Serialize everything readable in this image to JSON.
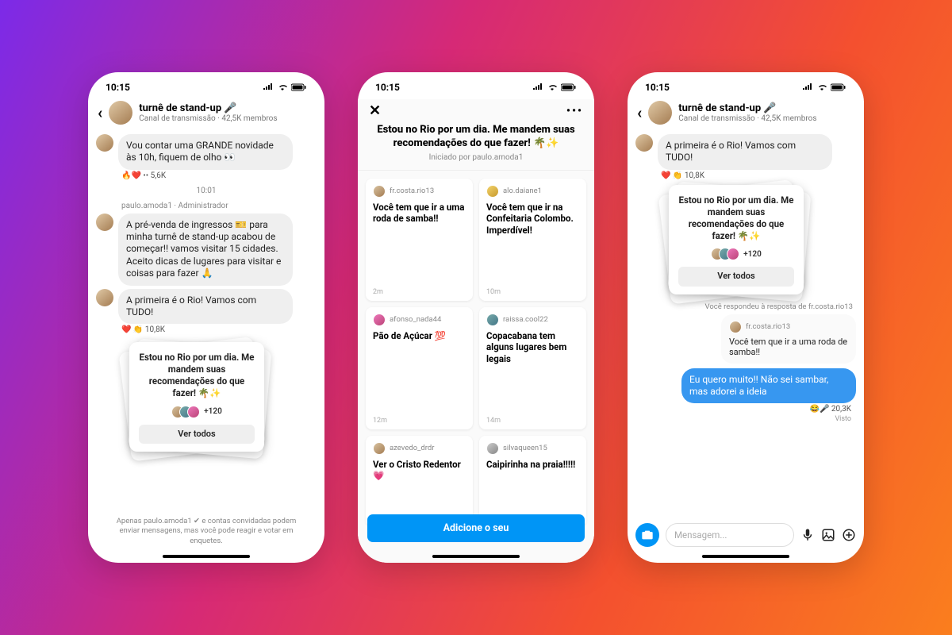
{
  "status_time": "10:15",
  "channel": {
    "title": "turnê de stand-up 🎤",
    "subtitle": "Canal de transmissão · 42,5K membros"
  },
  "phone1": {
    "msg1": "Vou contar uma GRANDE novidade às 10h, fiquem de olho 👀",
    "react1": "🔥❤️ •• 5,6K",
    "time": "10:01",
    "meta": "paulo.amoda1 · Administrador",
    "msg2": "A pré-venda de ingressos 🎫 para minha turnê de stand-up acabou de começar!! vamos visitar 15 cidades. Aceito dicas de lugares para visitar e coisas para fazer 🙏",
    "msg3": "A primeira é o Rio! Vamos com TUDO!",
    "react3": "❤️ 👏 10,8K",
    "card_title": "Estou no Rio por um dia. Me mandem suas recomendações do que fazer! 🌴✨",
    "card_count": "+120",
    "card_btn": "Ver todos",
    "footer": "Apenas paulo.amoda1 ✔ e contas convidadas podem enviar mensagens, mas você pode reagir e votar em enquetes."
  },
  "phone2": {
    "title": "Estou no Rio por um dia. Me mandem suas recomendações do que fazer! 🌴✨",
    "subtitle": "Iniciado por paulo.amoda1",
    "add_btn": "Adicione o seu",
    "cards": [
      {
        "user": "fr.costa.rio13",
        "text": "Você tem que ir a uma roda de samba!!",
        "time": "2m"
      },
      {
        "user": "alo.daiane1",
        "text": "Você tem que ir na Confeitaria Colombo. Imperdível!",
        "time": "10m"
      },
      {
        "user": "afonso_nada44",
        "text": "Pão de Açúcar 💯",
        "time": "12m"
      },
      {
        "user": "raissa.cool22",
        "text": "Copacabana tem alguns lugares bem legais",
        "time": "14m"
      },
      {
        "user": "azevedo_drdr",
        "text": "Ver o Cristo Redentor 💗",
        "time": ""
      },
      {
        "user": "silvaqueen15",
        "text": "Caipirinha na praia!!!!!",
        "time": ""
      }
    ]
  },
  "phone3": {
    "msg1": "A primeira é o Rio! Vamos com TUDO!",
    "react1": "❤️ 👏 10,8K",
    "card_title": "Estou no Rio por um dia. Me mandem suas recomendações do que fazer! 🌴✨",
    "card_count": "+120",
    "card_btn": "Ver todos",
    "reply_context": "Você respondeu à resposta de fr.costa.rio13",
    "quote_user": "fr.costa.rio13",
    "quote_text": "Você tem que ir a uma roda de samba!!",
    "my_reply": "Eu quero muito!! Não sei sambar, mas adorei a ideia",
    "react_reply": "😂🎤 20,3K",
    "seen": "Visto",
    "placeholder": "Mensagem..."
  }
}
